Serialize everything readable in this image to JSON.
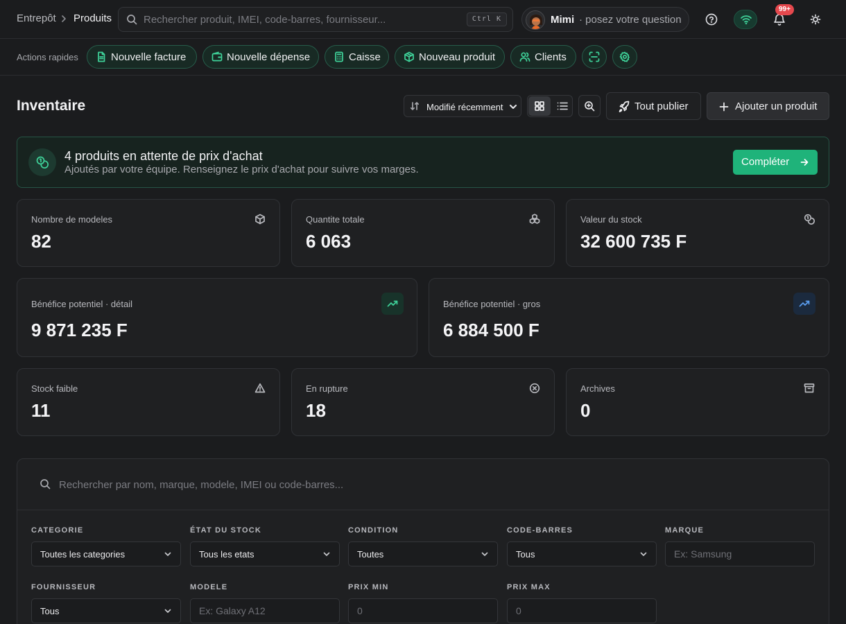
{
  "breadcrumb": {
    "parent": "Entrepôt",
    "current": "Produits"
  },
  "global_search": {
    "placeholder": "Rechercher produit, IMEI, code-barres, fournisseur...",
    "shortcut": "Ctrl K"
  },
  "assistant": {
    "name": "Mimi",
    "hint": "· posez votre question"
  },
  "notifications": {
    "badge": "99+"
  },
  "quick_actions": {
    "label": "Actions rapides",
    "items": [
      {
        "label": "Nouvelle facture",
        "icon": "file-icon"
      },
      {
        "label": "Nouvelle dépense",
        "icon": "wallet-icon"
      },
      {
        "label": "Caisse",
        "icon": "calculator-icon"
      },
      {
        "label": "Nouveau produit",
        "icon": "package-icon"
      },
      {
        "label": "Clients",
        "icon": "users-icon"
      }
    ]
  },
  "page": {
    "title": "Inventaire",
    "sort_value": "Modifié récemment",
    "publish_label": "Tout publier",
    "add_label": "Ajouter un produit"
  },
  "alert": {
    "title": "4 produits en attente de prix d'achat",
    "subtitle": "Ajoutés par votre équipe. Renseignez le prix d'achat pour suivre vos marges.",
    "button": "Compléter"
  },
  "stats": {
    "models": {
      "label": "Nombre de modeles",
      "value": "82"
    },
    "quantity": {
      "label": "Quantite totale",
      "value": "6 063"
    },
    "stock_value": {
      "label": "Valeur du stock",
      "value": "32 600 735 F"
    },
    "profit_retail": {
      "label": "Bénéfice potentiel · détail",
      "value": "9 871 235 F"
    },
    "profit_wholesale": {
      "label": "Bénéfice potentiel · gros",
      "value": "6 884 500 F"
    },
    "low_stock": {
      "label": "Stock faible",
      "value": "11"
    },
    "out_of_stock": {
      "label": "En rupture",
      "value": "18"
    },
    "archives": {
      "label": "Archives",
      "value": "0"
    }
  },
  "colors": {
    "accent": "#1fb37a",
    "accent_text": "#3fd39a",
    "info": "#5b9ef0",
    "danger": "#e5484d"
  },
  "filters": {
    "search_placeholder": "Rechercher par nom, marque, modele, IMEI ou code-barres...",
    "category": {
      "label": "CATEGORIE",
      "value": "Toutes les categories"
    },
    "stock_state": {
      "label": "ÉTAT DU STOCK",
      "value": "Tous les etats"
    },
    "condition": {
      "label": "CONDITION",
      "value": "Toutes"
    },
    "barcode": {
      "label": "CODE-BARRES",
      "value": "Tous"
    },
    "brand": {
      "label": "MARQUE",
      "placeholder": "Ex: Samsung"
    },
    "supplier": {
      "label": "FOURNISSEUR",
      "value": "Tous"
    },
    "model": {
      "label": "MODELE",
      "placeholder": "Ex: Galaxy A12"
    },
    "price_min": {
      "label": "PRIX MIN",
      "placeholder": "0"
    },
    "price_max": {
      "label": "PRIX MAX",
      "placeholder": "0"
    }
  }
}
